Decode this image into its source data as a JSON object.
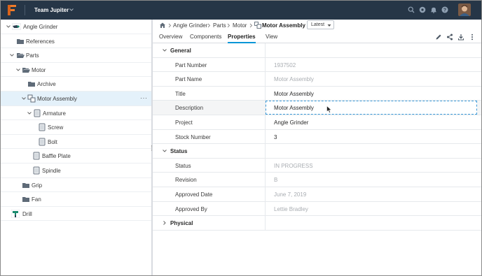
{
  "topbar": {
    "team_name": "Team Jupiter",
    "icons": [
      "search-icon",
      "help-circle-icon",
      "bell-icon",
      "question-icon"
    ]
  },
  "tree": {
    "items": [
      {
        "label": "Angle Grinder",
        "icon": "grinder-icon",
        "expanded": true
      },
      {
        "label": "References",
        "icon": "folder-icon"
      },
      {
        "label": "Parts",
        "icon": "folder-open-icon",
        "expanded": true
      },
      {
        "label": "Motor",
        "icon": "folder-open-icon",
        "expanded": true
      },
      {
        "label": "Archive",
        "icon": "folder-icon"
      },
      {
        "label": "Motor Assembly",
        "icon": "assembly-icon",
        "expanded": true,
        "selected": true,
        "more": "···"
      },
      {
        "label": "Armature",
        "icon": "component-icon",
        "expanded": true
      },
      {
        "label": "Screw",
        "icon": "component-icon"
      },
      {
        "label": "Bolt",
        "icon": "component-icon"
      },
      {
        "label": "Baffle Plate",
        "icon": "component-icon"
      },
      {
        "label": "Spindle",
        "icon": "component-icon"
      },
      {
        "label": "Grip",
        "icon": "folder-icon"
      },
      {
        "label": "Fan",
        "icon": "folder-icon"
      },
      {
        "label": "Drill",
        "icon": "drill-icon"
      }
    ]
  },
  "breadcrumb": {
    "items": [
      "Angle Grinder",
      "Parts",
      "Motor",
      "Motor Assembly"
    ],
    "version": "Latest"
  },
  "tabs": [
    "Overview",
    "Components",
    "Properties",
    "View"
  ],
  "active_tab": "Properties",
  "actions": [
    "edit-icon",
    "share-icon",
    "download-icon",
    "more-icon"
  ],
  "properties": {
    "general_label": "General",
    "status_label": "Status",
    "physical_label": "Physical",
    "general": [
      {
        "key": "Part Number",
        "value": "1937502"
      },
      {
        "key": "Part Name",
        "value": "Motor Assembly"
      },
      {
        "key": "Title",
        "value": "Motor Assembly"
      },
      {
        "key": "Description",
        "value": "Motor Assembly"
      },
      {
        "key": "Project",
        "value": "Angle Grinder"
      },
      {
        "key": "Stock Number",
        "value": "3"
      }
    ],
    "status": [
      {
        "key": "Status",
        "value": "IN PROGRESS"
      },
      {
        "key": "Revision",
        "value": "B"
      },
      {
        "key": "Approved Date",
        "value": "June 7, 2019"
      },
      {
        "key": "Approved By",
        "value": "Lettie Bradley"
      }
    ]
  },
  "colors": {
    "topbar_bg": "#263647",
    "accent": "#0696d7",
    "logo_orange": "#f07c2a",
    "selected_row": "#e4f1fa"
  }
}
